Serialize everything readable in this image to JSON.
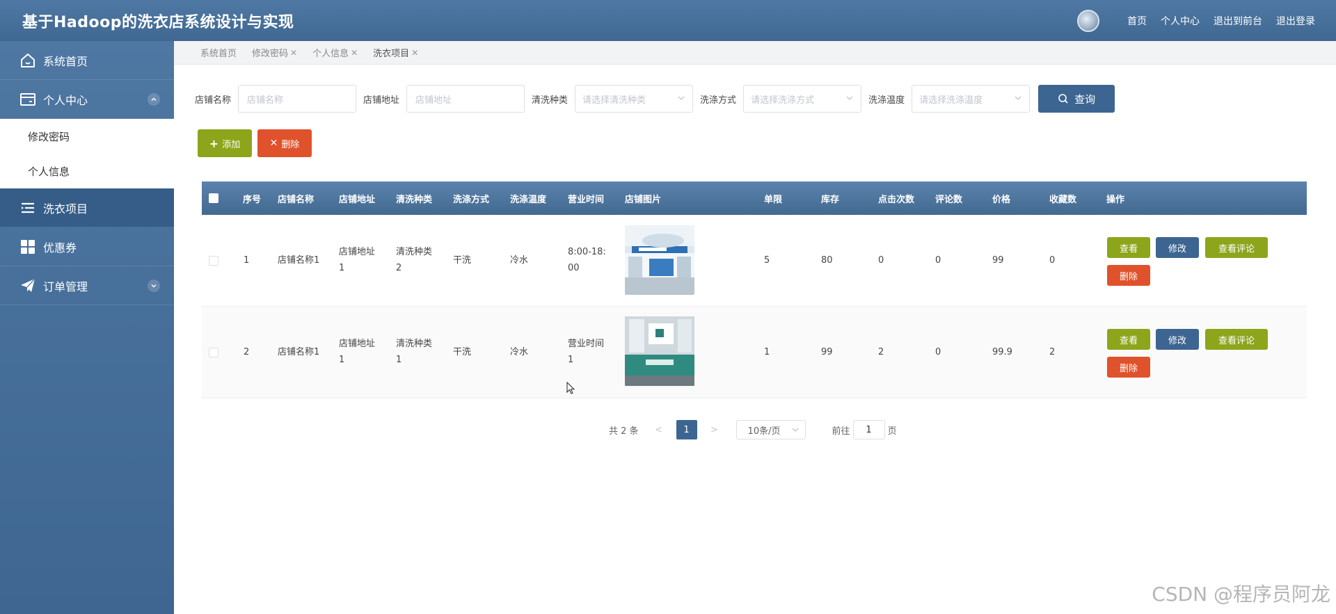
{
  "header": {
    "title": "基于Hadoop的洗衣店系统设计与实现",
    "nav": [
      "首页",
      "个人中心",
      "退出到前台",
      "退出登录"
    ]
  },
  "sidebar": {
    "items": [
      {
        "label": "系统首页",
        "icon": "home-icon"
      },
      {
        "label": "个人中心",
        "icon": "card-icon",
        "expanded": true,
        "children": [
          "修改密码",
          "个人信息"
        ]
      },
      {
        "label": "洗衣项目",
        "icon": "list-icon",
        "active": true
      },
      {
        "label": "优惠券",
        "icon": "grid-icon"
      },
      {
        "label": "订单管理",
        "icon": "paper-plane-icon",
        "expanded": false
      }
    ]
  },
  "tabs": [
    {
      "label": "系统首页",
      "closable": false
    },
    {
      "label": "修改密码",
      "closable": true
    },
    {
      "label": "个人信息",
      "closable": true
    },
    {
      "label": "洗衣项目",
      "closable": true
    }
  ],
  "search": {
    "shop_name_label": "店铺名称",
    "shop_name_placeholder": "店铺名称",
    "shop_addr_label": "店铺地址",
    "shop_addr_placeholder": "店铺地址",
    "clean_type_label": "清洗种类",
    "clean_type_placeholder": "请选择清洗种类",
    "wash_method_label": "洗涤方式",
    "wash_method_placeholder": "请选择洗涤方式",
    "wash_temp_label": "洗涤温度",
    "wash_temp_placeholder": "请选择洗涤温度",
    "query_label": "查询"
  },
  "actions": {
    "add_label": "添加",
    "delete_label": "删除"
  },
  "table": {
    "headers": [
      "序号",
      "店铺名称",
      "店铺地址",
      "清洗种类",
      "洗涤方式",
      "洗涤温度",
      "营业时间",
      "店铺图片",
      "单限",
      "库存",
      "点击次数",
      "评论数",
      "价格",
      "收藏数",
      "操作"
    ],
    "rows": [
      {
        "index": "1",
        "shop_name": "店铺名称1",
        "shop_addr_1": "店铺地址",
        "shop_addr_2": "1",
        "clean_type_1": "清洗种类",
        "clean_type_2": "2",
        "wash_method": "干洗",
        "wash_temp": "冷水",
        "hours_1": "8:00-18:",
        "hours_2": "00",
        "limit": "5",
        "stock": "80",
        "clicks": "0",
        "comments": "0",
        "price": "99",
        "favorites": "0"
      },
      {
        "index": "2",
        "shop_name": "店铺名称1",
        "shop_addr_1": "店铺地址",
        "shop_addr_2": "1",
        "clean_type_1": "清洗种类",
        "clean_type_2": "1",
        "wash_method": "干洗",
        "wash_temp": "冷水",
        "hours_1": "营业时间",
        "hours_2": "1",
        "limit": "1",
        "stock": "99",
        "clicks": "2",
        "comments": "0",
        "price": "99.9",
        "favorites": "2"
      }
    ],
    "op_labels": {
      "view": "查看",
      "edit": "修改",
      "comments": "查看评论",
      "delete": "删除"
    }
  },
  "pagination": {
    "total_text": "共 2 条",
    "current_page": "1",
    "page_size": "10条/页",
    "goto_label": "前往",
    "goto_value": "1",
    "page_suffix": "页"
  },
  "watermark": "CSDN @程序员阿龙",
  "colors": {
    "header_bg": "#4f79a4",
    "primary": "#3d6591",
    "success": "#8ca51b",
    "danger": "#e0522b"
  }
}
